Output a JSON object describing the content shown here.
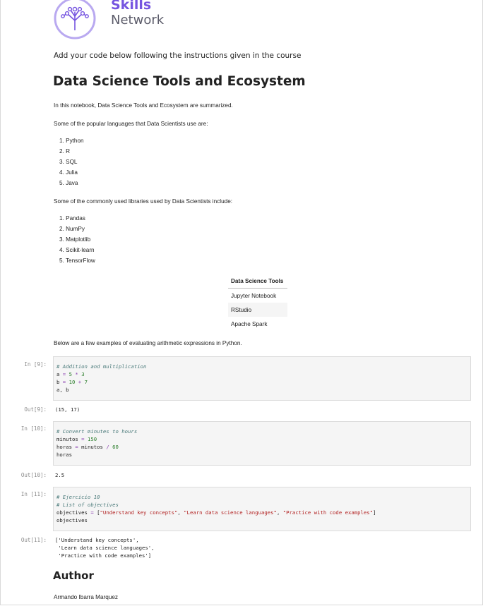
{
  "logo": {
    "line1": "Skills",
    "line2": "Network"
  },
  "instruction": "Add your code below following the instructions given in the course",
  "title": "Data Science Tools and Ecosystem",
  "intro": "In this notebook, Data Science Tools and Ecosystem are summarized.",
  "languages_heading": "Some of the popular languages that Data Scientists use are:",
  "languages": [
    "1. Python",
    "2. R",
    "3. SQL",
    "4. Julia",
    "5. Java"
  ],
  "libraries_heading": "Some of the commonly used libraries used by Data Scientists include:",
  "libraries": [
    "1. Pandas",
    "2. NumPy",
    "3. Matplotlib",
    "4. Scikit-learn",
    "5. TensorFlow"
  ],
  "tools_table": {
    "header": "Data Science Tools",
    "rows": [
      "Jupyter Notebook",
      "RStudio",
      "Apache Spark"
    ]
  },
  "arith_intro": "Below are a few examples of evaluating arithmetic expressions in Python.",
  "cells": [
    {
      "in_prompt": "In [9]:",
      "lines": {
        "l1_comment": "# Addition and multiplication",
        "l2_var": "a",
        "l2_eq": " = ",
        "l2_n1": "5",
        "l2_op": " * ",
        "l2_n2": "3",
        "l3_var": "b",
        "l3_eq": " = ",
        "l3_n1": "10",
        "l3_op": " + ",
        "l3_n2": "7",
        "l4": "a, b"
      },
      "out_prompt": "Out[9]:",
      "output": "(15, 17)"
    },
    {
      "in_prompt": "In [10]:",
      "lines": {
        "l1_comment": "# Convert minutes to hours",
        "l2_var": "minutos",
        "l2_eq": " = ",
        "l2_n1": "150",
        "l3_var": "horas",
        "l3_eq": " = ",
        "l3_mid": "minutos",
        "l3_op": " / ",
        "l3_n2": "60",
        "l4": "horas"
      },
      "out_prompt": "Out[10]:",
      "output": "2.5"
    },
    {
      "in_prompt": "In [11]:",
      "lines": {
        "l1_comment": "# Ejercicio 10",
        "l2_comment": "# List of objectives",
        "l3_var": "objectives",
        "l3_eq": " = ",
        "l3_open": "[",
        "s1": "\"Understand key concepts\"",
        "sep1": ", ",
        "s2": "\"Learn data science languages\"",
        "sep2": ", ",
        "s3": "\"Practice with code examples\"",
        "l3_close": "]",
        "l4": "objectives"
      },
      "out_prompt": "Out[11]:",
      "output_lines": [
        "['Understand key concepts',",
        " 'Learn data science languages',",
        " 'Practice with code examples']"
      ]
    }
  ],
  "author_heading": "Author",
  "author_name": "Armando Ibarra Marquez",
  "colors": {
    "brand_purple": "#7655e0",
    "logo_gray": "#5d5d6b",
    "cell_bg": "#f5f5f5"
  }
}
